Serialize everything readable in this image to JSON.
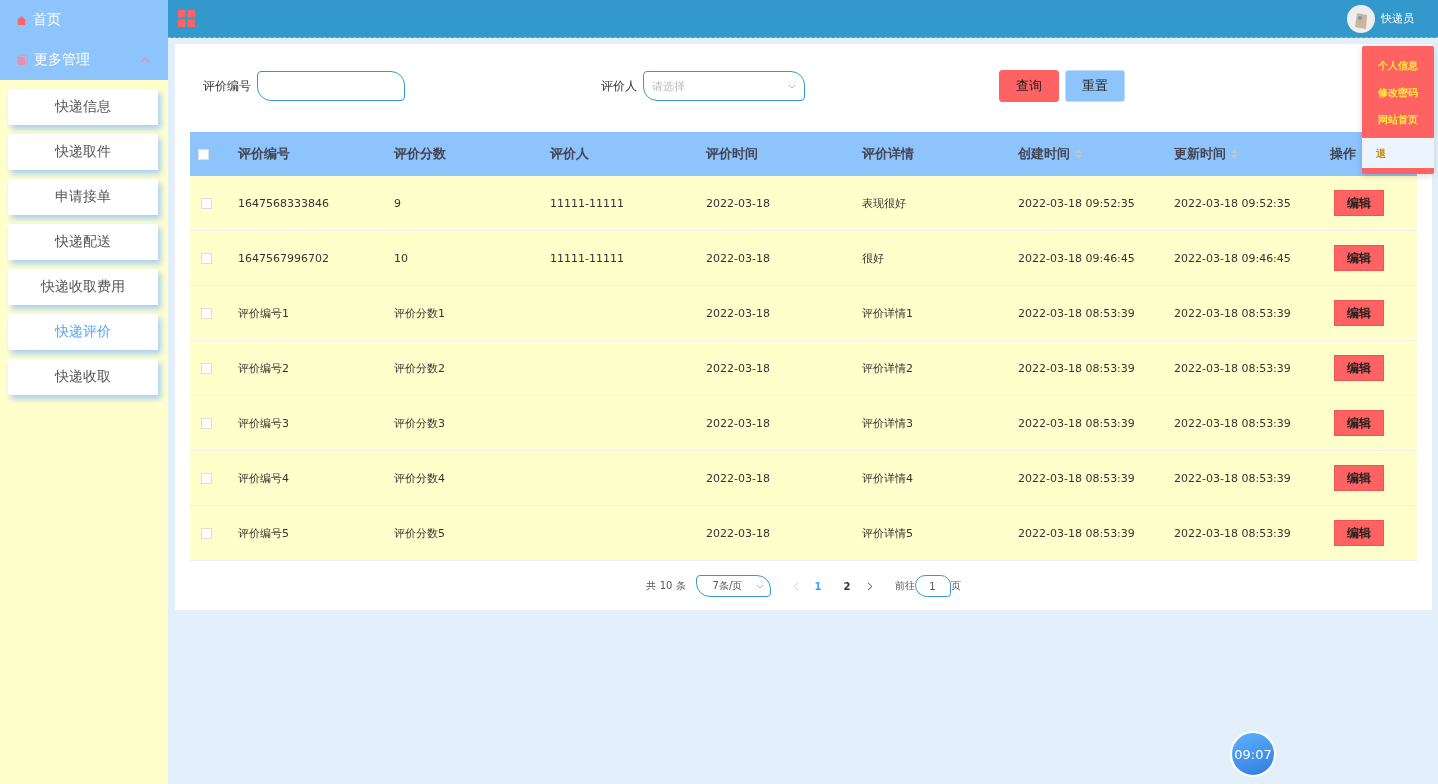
{
  "sidebar": {
    "home": "首页",
    "group": {
      "label": "更多管理",
      "expanded": true,
      "items": [
        {
          "label": "快递信息",
          "selected": false
        },
        {
          "label": "快递取件",
          "selected": false
        },
        {
          "label": "申请接单",
          "selected": false
        },
        {
          "label": "快递配送",
          "selected": false
        },
        {
          "label": "快递收取费用",
          "selected": false
        },
        {
          "label": "快递评价",
          "selected": true
        },
        {
          "label": "快递收取",
          "selected": false
        }
      ]
    }
  },
  "header": {
    "user": "快递员",
    "menu": [
      {
        "label": "个人信息",
        "hovered": false
      },
      {
        "label": "修改密码",
        "hovered": false
      },
      {
        "label": "网站首页",
        "hovered": false
      },
      {
        "label": "退",
        "hovered": true
      }
    ]
  },
  "search": {
    "fields": [
      {
        "label": "评价编号",
        "kind": "text"
      },
      {
        "label": "评价人",
        "kind": "select",
        "placeholder": "请选择"
      }
    ],
    "buttons": [
      {
        "label": "查询",
        "kind": "primary"
      },
      {
        "label": "重置",
        "kind": "secondary"
      }
    ]
  },
  "table": {
    "all_checked": false,
    "columns": [
      {
        "label": "评价编号",
        "sortable": false
      },
      {
        "label": "评价分数",
        "sortable": false
      },
      {
        "label": "评价人",
        "sortable": false
      },
      {
        "label": "评价时间",
        "sortable": false
      },
      {
        "label": "评价详情",
        "sortable": false
      },
      {
        "label": "创建时间",
        "sortable": true
      },
      {
        "label": "更新时间",
        "sortable": true
      },
      {
        "label": "操作",
        "sortable": false
      }
    ],
    "rows": [
      {
        "checked": false,
        "cells": [
          "1647568333846",
          "9",
          "11111-11111",
          "2022-03-18",
          "表现很好",
          "2022-03-18 09:52:35",
          "2022-03-18 09:52:35"
        ],
        "action": "编辑"
      },
      {
        "checked": false,
        "cells": [
          "1647567996702",
          "10",
          "11111-11111",
          "2022-03-18",
          "很好",
          "2022-03-18 09:46:45",
          "2022-03-18 09:46:45"
        ],
        "action": "编辑"
      },
      {
        "checked": false,
        "cells": [
          "评价编号1",
          "评价分数1",
          "",
          "2022-03-18",
          "评价详情1",
          "2022-03-18 08:53:39",
          "2022-03-18 08:53:39"
        ],
        "action": "编辑"
      },
      {
        "checked": false,
        "cells": [
          "评价编号2",
          "评价分数2",
          "",
          "2022-03-18",
          "评价详情2",
          "2022-03-18 08:53:39",
          "2022-03-18 08:53:39"
        ],
        "action": "编辑"
      },
      {
        "checked": false,
        "cells": [
          "评价编号3",
          "评价分数3",
          "",
          "2022-03-18",
          "评价详情3",
          "2022-03-18 08:53:39",
          "2022-03-18 08:53:39"
        ],
        "action": "编辑"
      },
      {
        "checked": false,
        "cells": [
          "评价编号4",
          "评价分数4",
          "",
          "2022-03-18",
          "评价详情4",
          "2022-03-18 08:53:39",
          "2022-03-18 08:53:39"
        ],
        "action": "编辑"
      },
      {
        "checked": false,
        "cells": [
          "评价编号5",
          "评价分数5",
          "",
          "2022-03-18",
          "评价详情5",
          "2022-03-18 08:53:39",
          "2022-03-18 08:53:39"
        ],
        "action": "编辑"
      }
    ]
  },
  "pagination": {
    "total": "共 10 条",
    "page_size": "7条/页",
    "pages": [
      {
        "label": "1",
        "selected": true
      },
      {
        "label": "2",
        "selected": false
      }
    ],
    "goto_label": "前往",
    "goto_value": "1",
    "page_suffix": "页"
  },
  "clock": "09:07"
}
